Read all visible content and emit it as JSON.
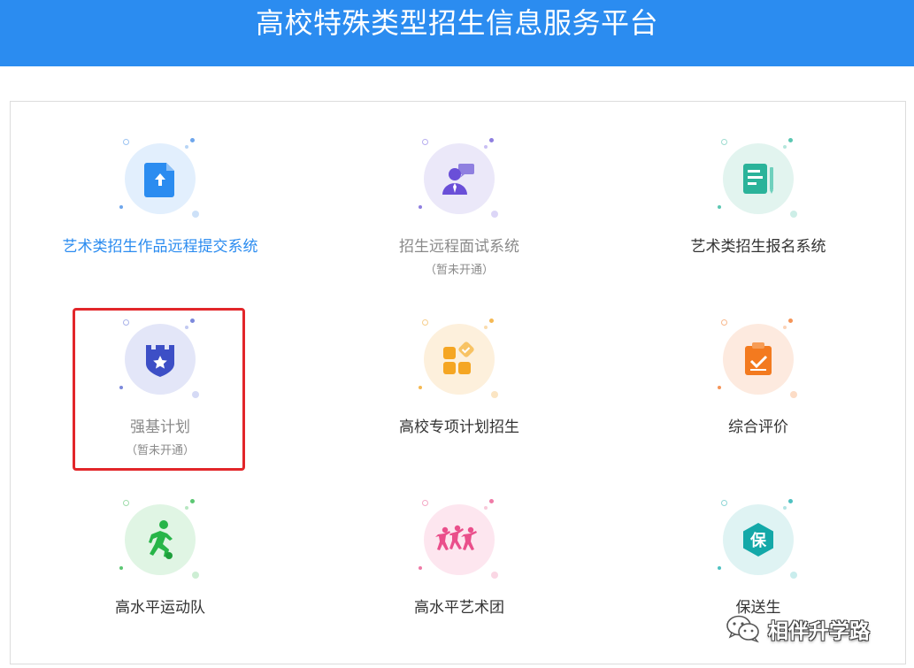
{
  "header": {
    "title": "高校特殊类型招生信息服务平台",
    "bg_color": "#2b8cf0"
  },
  "tiles": [
    {
      "label": "艺术类招生作品远程提交系统",
      "sublabel": "",
      "label_color": "#2b8cf0",
      "icon": "file-upload-icon",
      "circle_color": "#e2effd",
      "icon_color": "#2b8cf0"
    },
    {
      "label": "招生远程面试系统",
      "sublabel": "（暂未开通）",
      "label_color": "#8a8a8a",
      "icon": "interview-person-icon",
      "circle_color": "#ebe8f9",
      "icon_color": "#6a4fd8"
    },
    {
      "label": "艺术类招生报名系统",
      "sublabel": "",
      "label_color": "#333333",
      "icon": "registration-form-icon",
      "circle_color": "#e2f4ef",
      "icon_color": "#2bb39a"
    },
    {
      "label": "强基计划",
      "sublabel": "（暂未开通）",
      "label_color": "#8a8a8a",
      "icon": "shield-star-icon",
      "circle_color": "#e3e6f8",
      "icon_color": "#3d4fc6"
    },
    {
      "label": "高校专项计划招生",
      "sublabel": "",
      "label_color": "#333333",
      "icon": "blocks-check-icon",
      "circle_color": "#fdf0dc",
      "icon_color": "#f5a623"
    },
    {
      "label": "综合评价",
      "sublabel": "",
      "label_color": "#333333",
      "icon": "clipboard-check-icon",
      "circle_color": "#fdeadf",
      "icon_color": "#f37a1f"
    },
    {
      "label": "高水平运动队",
      "sublabel": "",
      "label_color": "#333333",
      "icon": "soccer-player-icon",
      "circle_color": "#e0f5e4",
      "icon_color": "#27b548"
    },
    {
      "label": "高水平艺术团",
      "sublabel": "",
      "label_color": "#333333",
      "icon": "dancers-icon",
      "circle_color": "#fde6ef",
      "icon_color": "#ea4f8b"
    },
    {
      "label": "保送生",
      "sublabel": "",
      "label_color": "#333333",
      "icon": "bao-badge-icon",
      "circle_color": "#dff3f3",
      "icon_color": "#14a8a8",
      "badge_text": "保"
    }
  ],
  "watermark": {
    "text": "相伴升学路",
    "icon": "wechat-icon"
  }
}
